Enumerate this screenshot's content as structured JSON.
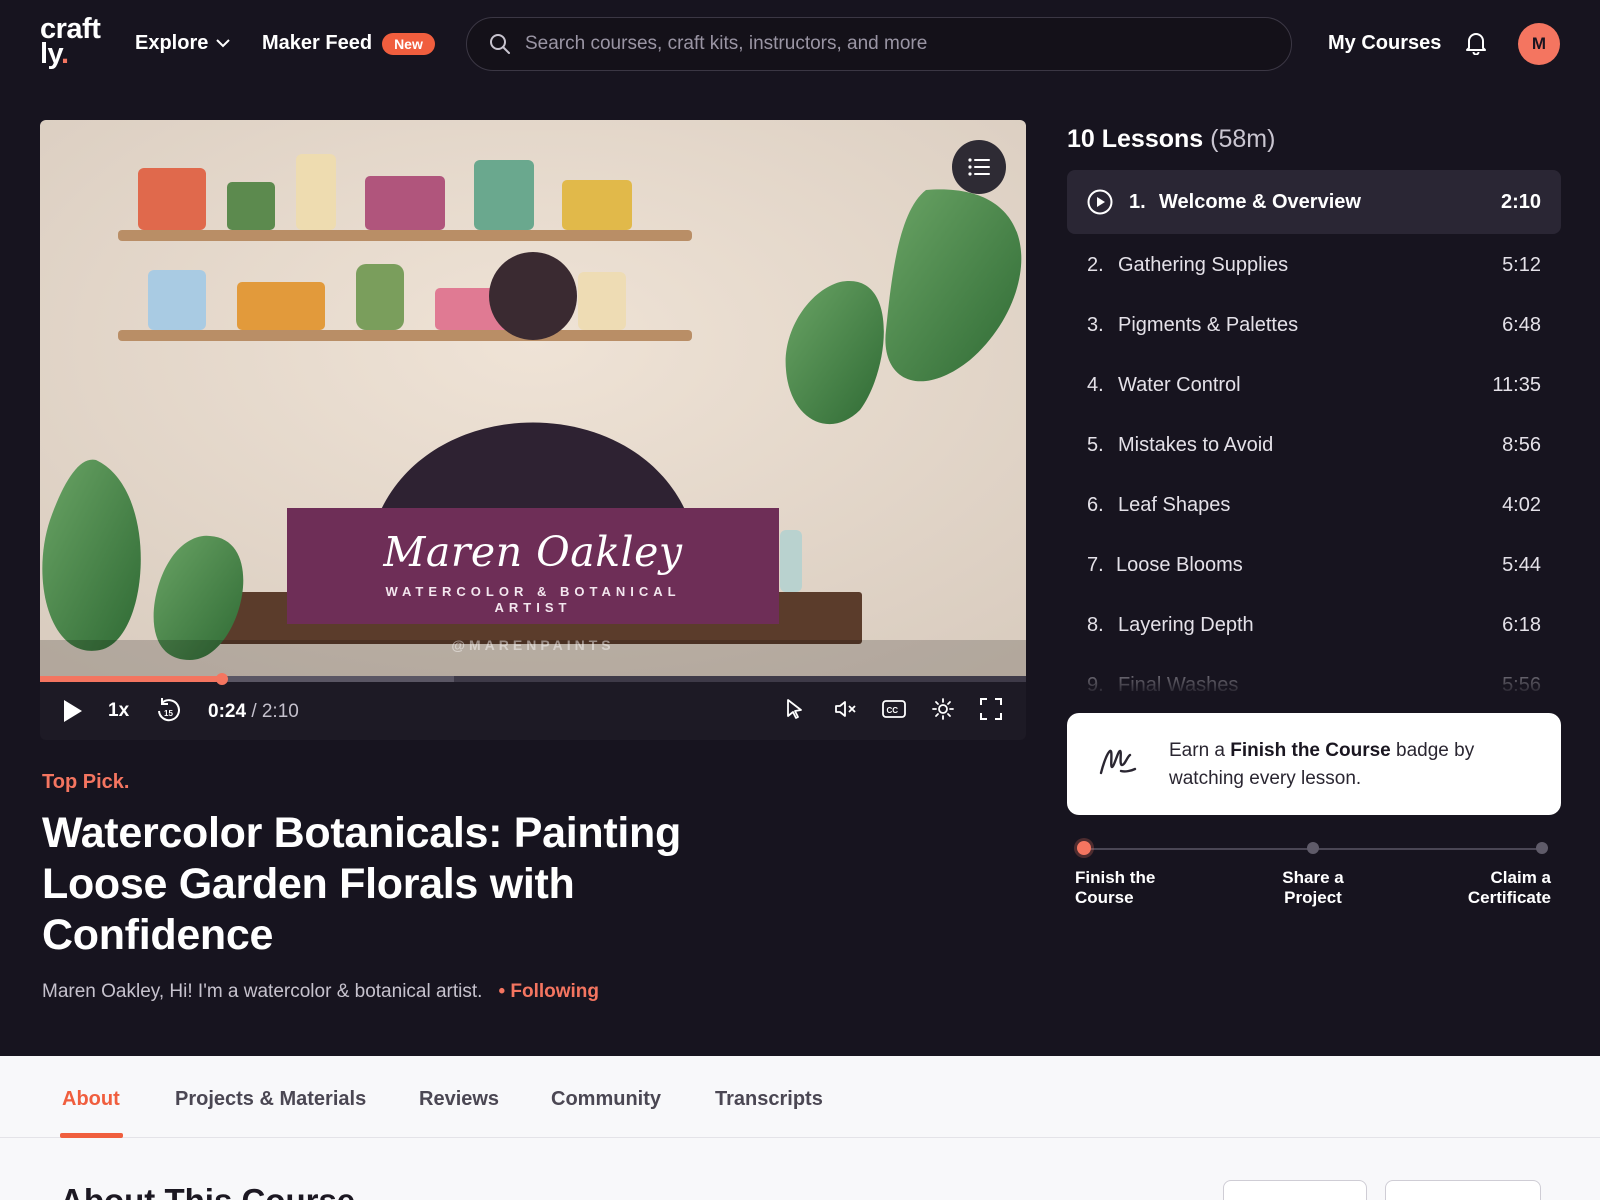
{
  "brand": {
    "logo_line1": "craft",
    "logo_line2": "ly",
    "logo_dot": "."
  },
  "nav": {
    "explore": "Explore",
    "maker_feed": "Maker Feed",
    "new_badge": "New",
    "search_placeholder": "Search courses, craft kits, instructors, and more",
    "my_courses": "My Courses",
    "avatar_initial": "M"
  },
  "video": {
    "instructor_name": "Maren Oakley",
    "instructor_title": "WATERCOLOR & BOTANICAL ARTIST",
    "handle": "@MARENPAINTS",
    "speed": "1x",
    "current_time": "0:24",
    "duration": "/ 2:10",
    "progress_fraction": 0.1846,
    "buffered_fraction": 0.42
  },
  "course": {
    "kicker": "Top Pick.",
    "title": "Watercolor Botanicals: Painting Loose Garden Florals with Confidence",
    "byline": "Maren Oakley, Hi! I'm a watercolor & botanical artist.",
    "following": "• Following"
  },
  "lessons": {
    "count_label": "10 Lessons",
    "total_duration": "(58m)",
    "items": [
      {
        "num": "1.",
        "title": "Welcome & Overview",
        "length": "2:10"
      },
      {
        "num": "2.",
        "title": "Gathering Supplies",
        "length": "5:12"
      },
      {
        "num": "3.",
        "title": "Pigments & Palettes",
        "length": "6:48"
      },
      {
        "num": "4.",
        "title": "Water Control",
        "length": "11:35"
      },
      {
        "num": "5.",
        "title": "Mistakes to Avoid",
        "length": "8:56"
      },
      {
        "num": "6.",
        "title": "Leaf Shapes",
        "length": "4:02"
      },
      {
        "num": "7.",
        "title": "Loose Blooms",
        "length": "5:44"
      },
      {
        "num": "8.",
        "title": "Layering Depth",
        "length": "6:18"
      },
      {
        "num": "9.",
        "title": "Final Washes",
        "length": "5:56"
      }
    ]
  },
  "badge": {
    "prefix": "Earn a",
    "name": "Finish the Course",
    "suffix": "badge by watching every lesson."
  },
  "steps": [
    "Finish the Course",
    "Share a Project",
    "Claim a Certificate"
  ],
  "tabs": [
    "About",
    "Projects & Materials",
    "Reviews",
    "Community",
    "Transcripts"
  ],
  "about": {
    "heading": "About This Course"
  },
  "colors": {
    "accent": "#f47560",
    "background": "#17141f",
    "nameplate": "#6e2e57"
  },
  "icons": [
    "search-icon",
    "chevron-down-icon",
    "bell-icon",
    "list-icon",
    "play-icon",
    "rewind-15-icon",
    "cursor-icon",
    "mute-icon",
    "cc-icon",
    "settings-icon",
    "fullscreen-icon",
    "play-circle-icon",
    "signature-icon"
  ]
}
